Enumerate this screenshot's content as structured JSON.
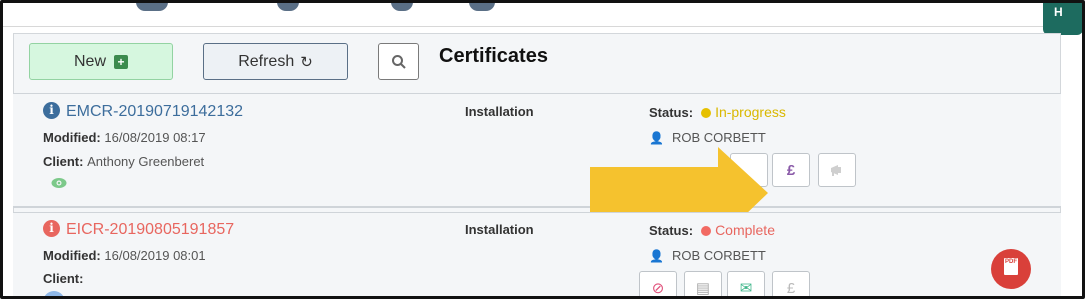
{
  "toolbar": {
    "new_label": "New",
    "refresh_label": "Refresh",
    "title": "Certificates"
  },
  "side_tab": {
    "label": "H"
  },
  "certificates": [
    {
      "ref": "EMCR-20190719142132",
      "ref_color": "#3c6d9c",
      "type": "Installation",
      "modified_label": "Modified:",
      "modified": "16/08/2019 08:17",
      "client_label": "Client:",
      "client": "Anthony Greenberet",
      "status_label": "Status:",
      "status": "In-progress",
      "status_color": "#e6c000",
      "user": "ROB CORBETT",
      "actions": [
        {
          "icon": "pound-icon",
          "glyph": "£"
        },
        {
          "icon": "megaphone-icon",
          "glyph": "📢"
        }
      ]
    },
    {
      "ref": "EICR-20190805191857",
      "ref_color": "#e8665f",
      "type": "Installation",
      "modified_label": "Modified:",
      "modified": "16/08/2019 08:01",
      "client_label": "Client:",
      "client": "",
      "status_label": "Status:",
      "status": "Complete",
      "status_color": "#f26a63",
      "user": "ROB CORBETT",
      "actions": [
        {
          "icon": "ban-icon",
          "glyph": "⊘"
        },
        {
          "icon": "archive-icon",
          "glyph": "▤"
        },
        {
          "icon": "envelope-icon",
          "glyph": "✉"
        },
        {
          "icon": "pound-icon",
          "glyph": "£"
        }
      ]
    }
  ],
  "pdf_badge": {
    "label": "PDF"
  },
  "colors": {
    "accent_green": "#1d6b5f",
    "highlight_arrow": "#f5c22e"
  }
}
